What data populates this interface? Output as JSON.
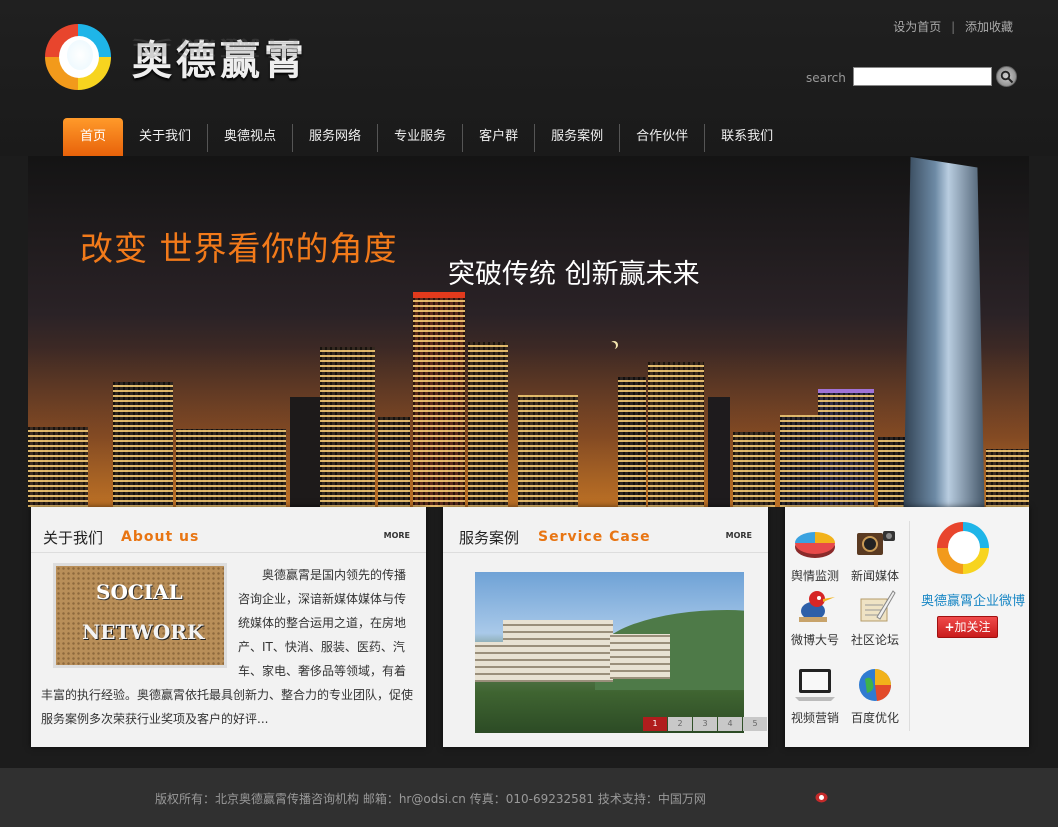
{
  "header": {
    "logo_text": "奥德赢霄",
    "top_links": [
      "设为首页",
      "添加收藏"
    ],
    "top_links_separator": "|",
    "search_label": "search",
    "search_value": ""
  },
  "nav": {
    "items": [
      "首页",
      "关于我们",
      "奥德视点",
      "服务网络",
      "专业服务",
      "客户群",
      "服务案例",
      "合作伙伴",
      "联系我们"
    ],
    "active_index": 0
  },
  "banner": {
    "slogan": "改变  世界看你的角度",
    "subslogan": "突破传统   创新赢未来"
  },
  "about": {
    "title": "关于我们",
    "title_en": "About us",
    "more": "MORE",
    "image_words": [
      "SOCIAL",
      "NETWORK"
    ],
    "text": "奥德赢霄是国内领先的传播咨询企业，深谙新媒体媒体与传统媒体的整合运用之道，在房地产、IT、快消、服装、医药、汽车、家电、奢侈品等领域，有着丰富的执行经验。奥德赢霄依托最具创新力、整合力的专业团队，促使服务案例多次荣获行业奖项及客户的好评..."
  },
  "cases": {
    "title": "服务案例",
    "title_en": "Service Case",
    "more": "MORE",
    "pages": [
      "1",
      "2",
      "3",
      "4",
      "5"
    ],
    "active_page": 0
  },
  "services": {
    "items": [
      {
        "label": "舆情监测",
        "icon": "pie-chart-icon"
      },
      {
        "label": "新闻媒体",
        "icon": "camera-icon"
      },
      {
        "label": "微博大号",
        "icon": "woodpecker-icon"
      },
      {
        "label": "社区论坛",
        "icon": "scroll-quill-icon"
      },
      {
        "label": "视频营销",
        "icon": "laptop-icon"
      },
      {
        "label": "百度优化",
        "icon": "globe-chart-icon"
      }
    ],
    "weibo_name": "奥德赢霄企业微博",
    "follow_label": "加关注"
  },
  "footer": {
    "text": "版权所有：北京奥德赢霄传播咨询机构 邮箱：hr@odsi.cn  传真：010-69232581 技术支持：中国万网"
  },
  "colors": {
    "accent": "#e87513",
    "nav_active": "#f07a12",
    "link_blue": "#1886c4",
    "follow_red": "#d92727"
  }
}
